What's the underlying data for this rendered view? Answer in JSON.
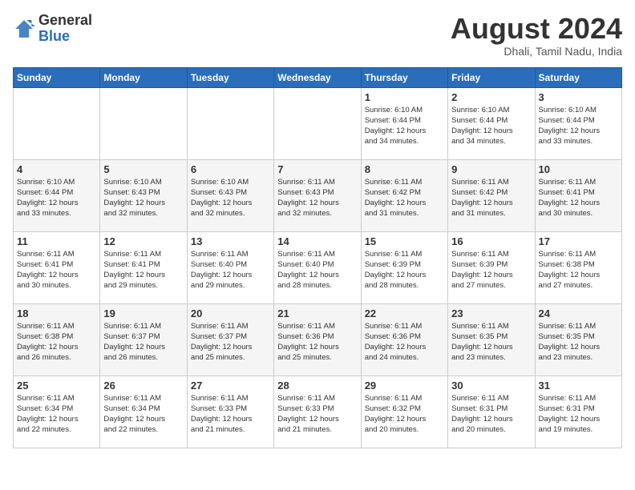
{
  "header": {
    "logo_general": "General",
    "logo_blue": "Blue",
    "month_title": "August 2024",
    "location": "Dhali, Tamil Nadu, India"
  },
  "days_of_week": [
    "Sunday",
    "Monday",
    "Tuesday",
    "Wednesday",
    "Thursday",
    "Friday",
    "Saturday"
  ],
  "weeks": [
    [
      {
        "day": "",
        "info": ""
      },
      {
        "day": "",
        "info": ""
      },
      {
        "day": "",
        "info": ""
      },
      {
        "day": "",
        "info": ""
      },
      {
        "day": "1",
        "info": "Sunrise: 6:10 AM\nSunset: 6:44 PM\nDaylight: 12 hours\nand 34 minutes."
      },
      {
        "day": "2",
        "info": "Sunrise: 6:10 AM\nSunset: 6:44 PM\nDaylight: 12 hours\nand 34 minutes."
      },
      {
        "day": "3",
        "info": "Sunrise: 6:10 AM\nSunset: 6:44 PM\nDaylight: 12 hours\nand 33 minutes."
      }
    ],
    [
      {
        "day": "4",
        "info": "Sunrise: 6:10 AM\nSunset: 6:44 PM\nDaylight: 12 hours\nand 33 minutes."
      },
      {
        "day": "5",
        "info": "Sunrise: 6:10 AM\nSunset: 6:43 PM\nDaylight: 12 hours\nand 32 minutes."
      },
      {
        "day": "6",
        "info": "Sunrise: 6:10 AM\nSunset: 6:43 PM\nDaylight: 12 hours\nand 32 minutes."
      },
      {
        "day": "7",
        "info": "Sunrise: 6:11 AM\nSunset: 6:43 PM\nDaylight: 12 hours\nand 32 minutes."
      },
      {
        "day": "8",
        "info": "Sunrise: 6:11 AM\nSunset: 6:42 PM\nDaylight: 12 hours\nand 31 minutes."
      },
      {
        "day": "9",
        "info": "Sunrise: 6:11 AM\nSunset: 6:42 PM\nDaylight: 12 hours\nand 31 minutes."
      },
      {
        "day": "10",
        "info": "Sunrise: 6:11 AM\nSunset: 6:41 PM\nDaylight: 12 hours\nand 30 minutes."
      }
    ],
    [
      {
        "day": "11",
        "info": "Sunrise: 6:11 AM\nSunset: 6:41 PM\nDaylight: 12 hours\nand 30 minutes."
      },
      {
        "day": "12",
        "info": "Sunrise: 6:11 AM\nSunset: 6:41 PM\nDaylight: 12 hours\nand 29 minutes."
      },
      {
        "day": "13",
        "info": "Sunrise: 6:11 AM\nSunset: 6:40 PM\nDaylight: 12 hours\nand 29 minutes."
      },
      {
        "day": "14",
        "info": "Sunrise: 6:11 AM\nSunset: 6:40 PM\nDaylight: 12 hours\nand 28 minutes."
      },
      {
        "day": "15",
        "info": "Sunrise: 6:11 AM\nSunset: 6:39 PM\nDaylight: 12 hours\nand 28 minutes."
      },
      {
        "day": "16",
        "info": "Sunrise: 6:11 AM\nSunset: 6:39 PM\nDaylight: 12 hours\nand 27 minutes."
      },
      {
        "day": "17",
        "info": "Sunrise: 6:11 AM\nSunset: 6:38 PM\nDaylight: 12 hours\nand 27 minutes."
      }
    ],
    [
      {
        "day": "18",
        "info": "Sunrise: 6:11 AM\nSunset: 6:38 PM\nDaylight: 12 hours\nand 26 minutes."
      },
      {
        "day": "19",
        "info": "Sunrise: 6:11 AM\nSunset: 6:37 PM\nDaylight: 12 hours\nand 26 minutes."
      },
      {
        "day": "20",
        "info": "Sunrise: 6:11 AM\nSunset: 6:37 PM\nDaylight: 12 hours\nand 25 minutes."
      },
      {
        "day": "21",
        "info": "Sunrise: 6:11 AM\nSunset: 6:36 PM\nDaylight: 12 hours\nand 25 minutes."
      },
      {
        "day": "22",
        "info": "Sunrise: 6:11 AM\nSunset: 6:36 PM\nDaylight: 12 hours\nand 24 minutes."
      },
      {
        "day": "23",
        "info": "Sunrise: 6:11 AM\nSunset: 6:35 PM\nDaylight: 12 hours\nand 23 minutes."
      },
      {
        "day": "24",
        "info": "Sunrise: 6:11 AM\nSunset: 6:35 PM\nDaylight: 12 hours\nand 23 minutes."
      }
    ],
    [
      {
        "day": "25",
        "info": "Sunrise: 6:11 AM\nSunset: 6:34 PM\nDaylight: 12 hours\nand 22 minutes."
      },
      {
        "day": "26",
        "info": "Sunrise: 6:11 AM\nSunset: 6:34 PM\nDaylight: 12 hours\nand 22 minutes."
      },
      {
        "day": "27",
        "info": "Sunrise: 6:11 AM\nSunset: 6:33 PM\nDaylight: 12 hours\nand 21 minutes."
      },
      {
        "day": "28",
        "info": "Sunrise: 6:11 AM\nSunset: 6:33 PM\nDaylight: 12 hours\nand 21 minutes."
      },
      {
        "day": "29",
        "info": "Sunrise: 6:11 AM\nSunset: 6:32 PM\nDaylight: 12 hours\nand 20 minutes."
      },
      {
        "day": "30",
        "info": "Sunrise: 6:11 AM\nSunset: 6:31 PM\nDaylight: 12 hours\nand 20 minutes."
      },
      {
        "day": "31",
        "info": "Sunrise: 6:11 AM\nSunset: 6:31 PM\nDaylight: 12 hours\nand 19 minutes."
      }
    ]
  ]
}
